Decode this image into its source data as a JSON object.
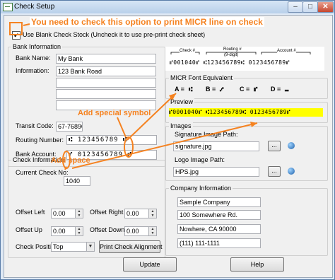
{
  "window": {
    "title": "Check Setup",
    "min_label": "–",
    "max_label": "□",
    "close_label": "✕"
  },
  "annotations": {
    "micr_option": "You need to check this option to print MICR line on check",
    "special_symbol": "Add special symbol",
    "space": "Add space",
    "color": "#f58220"
  },
  "blank_stock": {
    "checked": true,
    "check_mark": "✔",
    "label": "Use Blank Check Stock (Uncheck it to use pre-print check sheet)"
  },
  "bank_info": {
    "legend": "Bank Information",
    "bank_name_label": "Bank Name:",
    "bank_name_value": "My Bank",
    "information_label": "Information:",
    "info_lines": [
      "123 Bank Road",
      "",
      "",
      ""
    ],
    "transit_label": "Transit Code:",
    "transit_value": "67-76890",
    "routing_label": "Routing Number:",
    "routing_value": "⑆ 123456789 ⑆",
    "account_label": "Bank Account:",
    "account_value": "⑈ 0123456789 ⑈"
  },
  "check_info": {
    "legend": "Check Information",
    "current_label": "Current Check No:",
    "current_value": "1040",
    "offset_left_label": "Offset Left",
    "offset_left_value": "0.00",
    "offset_right_label": "Offset Right",
    "offset_right_value": "0.00",
    "offset_up_label": "Offset Up",
    "offset_up_value": "0.00",
    "offset_down_label": "Offset Down",
    "offset_down_value": "0.00",
    "position_label": "Check Position",
    "position_value": "Top",
    "align_button": "Print Check Alignment"
  },
  "micr_diagram": {
    "check_label": "Check #",
    "routing_label": "Routing #",
    "routing_sub": "(9-digit)",
    "account_label": "Account #",
    "sample_line": "⑈001040⑈ ⑆123456789⑆ 0123456789⑈"
  },
  "micr_font": {
    "legend": "MICR Font Equivalent",
    "a_label": "A =",
    "a_symbol": "⑆",
    "b_label": "B =",
    "b_symbol": "⑇",
    "c_label": "C =",
    "c_symbol": "⑈",
    "d_label": "D =",
    "d_symbol": "⑉"
  },
  "preview": {
    "legend": "Preview",
    "text": "⑈0001040⑈ ⑆123456789⑆ 0123456789⑈",
    "highlight": "#ffff00"
  },
  "images": {
    "legend": "Images",
    "signature_label": "Signature Image Path:",
    "signature_value": "signature.jpg",
    "logo_label": "Logo Image Path:",
    "logo_value": "HPS.jpg",
    "browse_label": "..."
  },
  "company": {
    "legend": "Company Information",
    "lines": [
      "Sample Company",
      "100 Somewhere Rd.",
      "Nowhere, CA 90000",
      "(111) 111-1111"
    ]
  },
  "buttons": {
    "update": "Update",
    "help": "Help"
  }
}
